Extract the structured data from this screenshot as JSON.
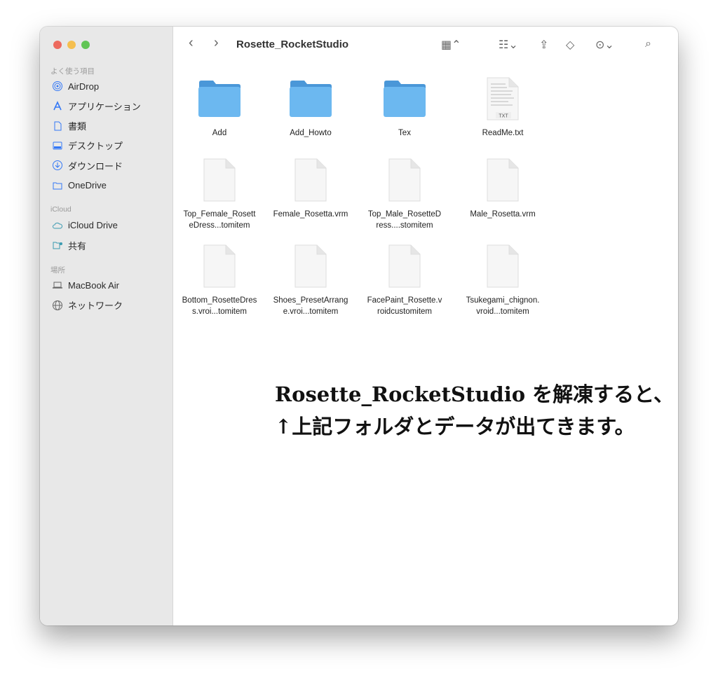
{
  "window": {
    "title": "Rosette_RocketStudio"
  },
  "sidebar": {
    "sections": [
      {
        "label": "よく使う項目",
        "items": [
          {
            "label": "AirDrop",
            "icon": "airdrop-icon"
          },
          {
            "label": "アプリケーション",
            "icon": "applications-icon"
          },
          {
            "label": "書類",
            "icon": "document-icon"
          },
          {
            "label": "デスクトップ",
            "icon": "desktop-icon"
          },
          {
            "label": "ダウンロード",
            "icon": "download-icon"
          },
          {
            "label": "OneDrive",
            "icon": "folder-icon"
          }
        ]
      },
      {
        "label": "iCloud",
        "items": [
          {
            "label": "iCloud Drive",
            "icon": "cloud-icon"
          },
          {
            "label": "共有",
            "icon": "shared-folder-icon"
          }
        ]
      },
      {
        "label": "場所",
        "items": [
          {
            "label": "MacBook Air",
            "icon": "laptop-icon"
          },
          {
            "label": "ネットワーク",
            "icon": "globe-icon"
          }
        ]
      }
    ]
  },
  "files": [
    {
      "name": "Add",
      "type": "folder"
    },
    {
      "name": "Add_Howto",
      "type": "folder"
    },
    {
      "name": "Tex",
      "type": "folder"
    },
    {
      "name": "ReadMe.txt",
      "type": "txt",
      "badge": "TXT"
    },
    {
      "name": "Top_Female_RosetteDress...tomitem",
      "type": "file"
    },
    {
      "name": "Female_Rosetta.vrm",
      "type": "file"
    },
    {
      "name": "Top_Male_RosetteDress....stomitem",
      "type": "file"
    },
    {
      "name": "Male_Rosetta.vrm",
      "type": "file"
    },
    {
      "name": "Bottom_RosetteDress.vroi...tomitem",
      "type": "file"
    },
    {
      "name": "Shoes_PresetArrange.vroi...tomitem",
      "type": "file"
    },
    {
      "name": "FacePaint_Rosette.vroidcustomitem",
      "type": "file"
    },
    {
      "name": "Tsukegami_chignon.vroid...tomitem",
      "type": "file"
    }
  ],
  "annotation": {
    "line1": "Rosette_RocketStudio を解凍すると、",
    "line2": "↑上記フォルダとデータが出てきます。"
  },
  "colors": {
    "accent": "#3478f6",
    "folder": "#6cb8f0"
  }
}
